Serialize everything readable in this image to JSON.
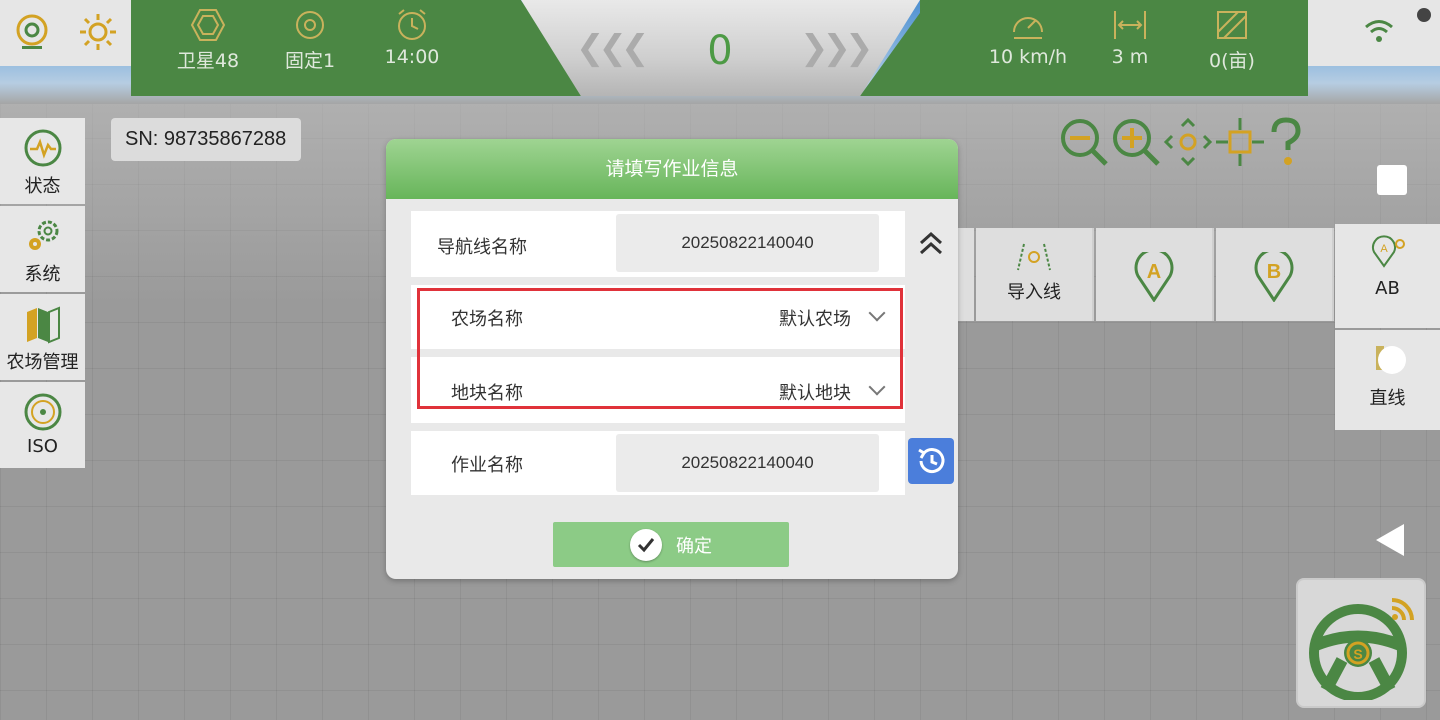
{
  "top_bar": {
    "stats_left": [
      {
        "icon": "satellite-icon",
        "label": "卫星48"
      },
      {
        "icon": "fix-target-icon",
        "label": "固定1"
      },
      {
        "icon": "alarm-clock-icon",
        "label": "14:00"
      }
    ],
    "speed_value": "0",
    "chevrons_left": "❮❮❮",
    "chevrons_right": "❯❯❯",
    "stats_right": [
      {
        "icon": "speedometer-icon",
        "label": "10 km/h"
      },
      {
        "icon": "width-icon",
        "label": "3 m"
      },
      {
        "icon": "area-icon",
        "label": "0(亩)"
      }
    ]
  },
  "sidebar": {
    "items": [
      {
        "icon": "pulse-icon",
        "label": "状态"
      },
      {
        "icon": "gears-icon",
        "label": "系统"
      },
      {
        "icon": "farm-map-icon",
        "label": "农场管理"
      },
      {
        "icon": "iso-icon",
        "label": "ISO"
      }
    ]
  },
  "sn": "SN: 98735867288",
  "tiles": {
    "import_line": "导入线",
    "ab": "AB",
    "straight": "直线"
  },
  "modal": {
    "title": "请填写作业信息",
    "nav_line_label": "导航线名称",
    "nav_line_value": "20250822140040",
    "farm_label": "农场名称",
    "farm_value": "默认农场",
    "plot_label": "地块名称",
    "plot_value": "默认地块",
    "job_label": "作业名称",
    "job_value": "20250822140040",
    "confirm_label": "确定"
  },
  "colors": {
    "primary_green": "#4b8744",
    "header_green": "#67b55a",
    "confirm_green": "#8ccb86",
    "highlight_red": "#e0323a",
    "history_blue": "#4b7edb"
  }
}
